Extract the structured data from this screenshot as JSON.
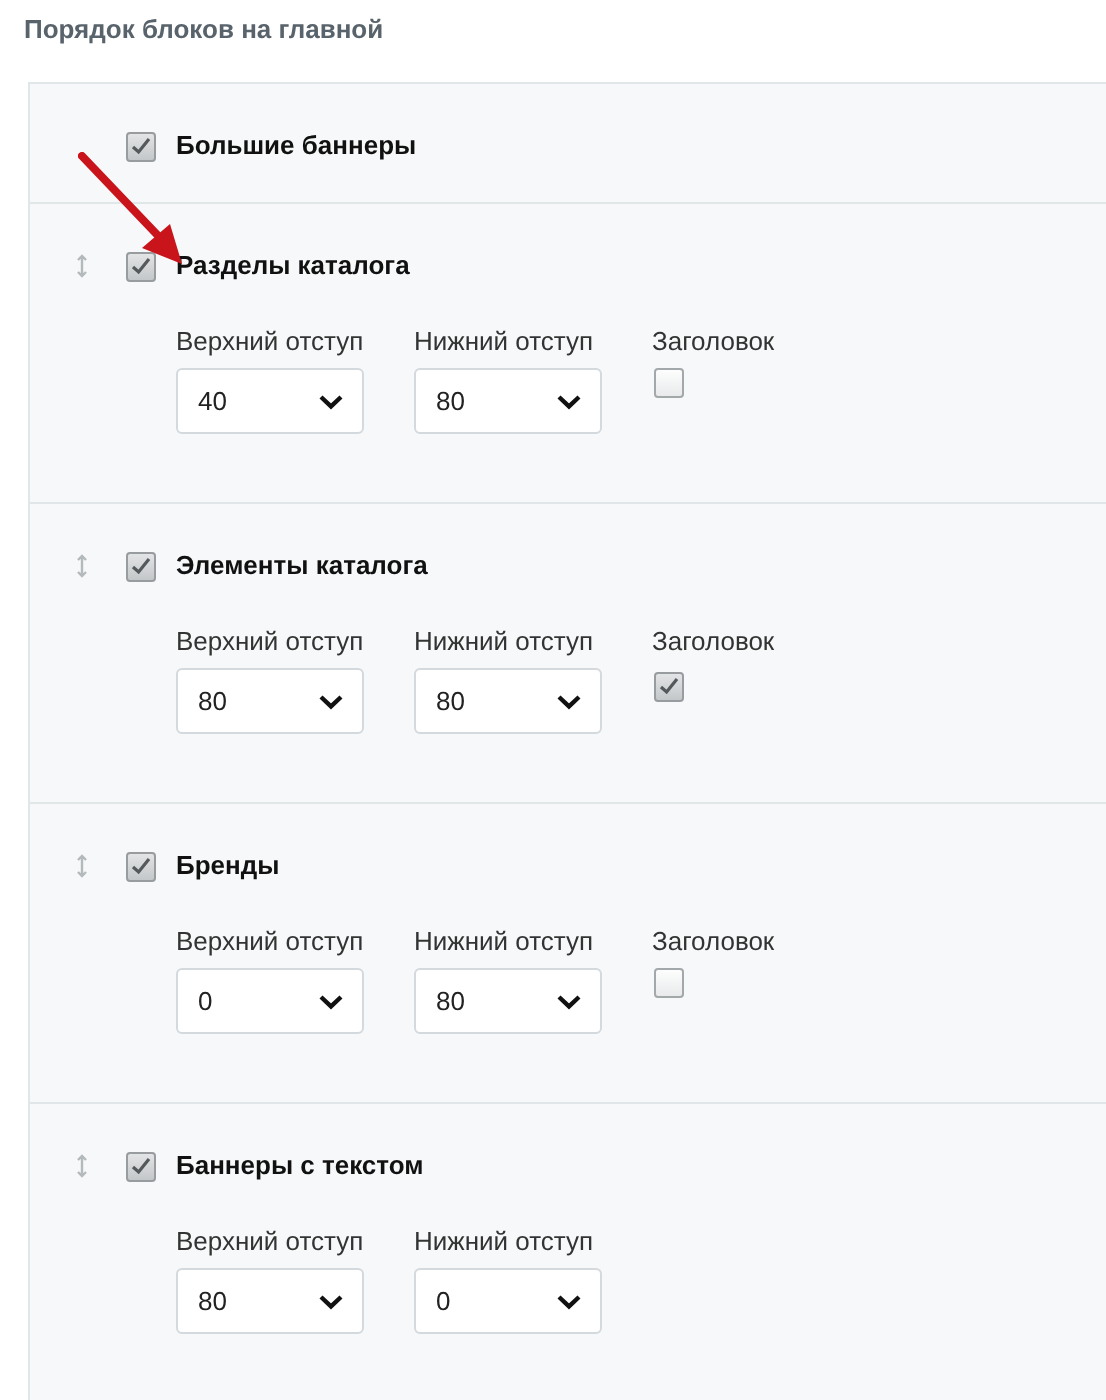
{
  "title": "Порядок блоков на главной",
  "blocks": [
    {
      "label": "Большие баннеры",
      "checked": true,
      "draggable": false,
      "pointer": false
    },
    {
      "label": "Разделы каталога",
      "checked": true,
      "draggable": true,
      "pointer": true,
      "fields": [
        {
          "kind": "select",
          "label": "Верхний отступ",
          "value": "40"
        },
        {
          "kind": "select",
          "label": "Нижний отступ",
          "value": "80"
        },
        {
          "kind": "checkbox",
          "label": "Заголовок",
          "checked": false
        }
      ]
    },
    {
      "label": "Элементы каталога",
      "checked": true,
      "draggable": true,
      "pointer": false,
      "fields": [
        {
          "kind": "select",
          "label": "Верхний отступ",
          "value": "80"
        },
        {
          "kind": "select",
          "label": "Нижний отступ",
          "value": "80"
        },
        {
          "kind": "checkbox",
          "label": "Заголовок",
          "checked": true
        }
      ]
    },
    {
      "label": "Бренды",
      "checked": true,
      "draggable": true,
      "pointer": false,
      "fields": [
        {
          "kind": "select",
          "label": "Верхний отступ",
          "value": "0"
        },
        {
          "kind": "select",
          "label": "Нижний отступ",
          "value": "80"
        },
        {
          "kind": "checkbox",
          "label": "Заголовок",
          "checked": false
        }
      ]
    },
    {
      "label": "Баннеры с текстом",
      "checked": true,
      "draggable": true,
      "pointer": false,
      "fields": [
        {
          "kind": "select",
          "label": "Верхний отступ",
          "value": "80"
        },
        {
          "kind": "select",
          "label": "Нижний отступ",
          "value": "0"
        }
      ]
    }
  ]
}
